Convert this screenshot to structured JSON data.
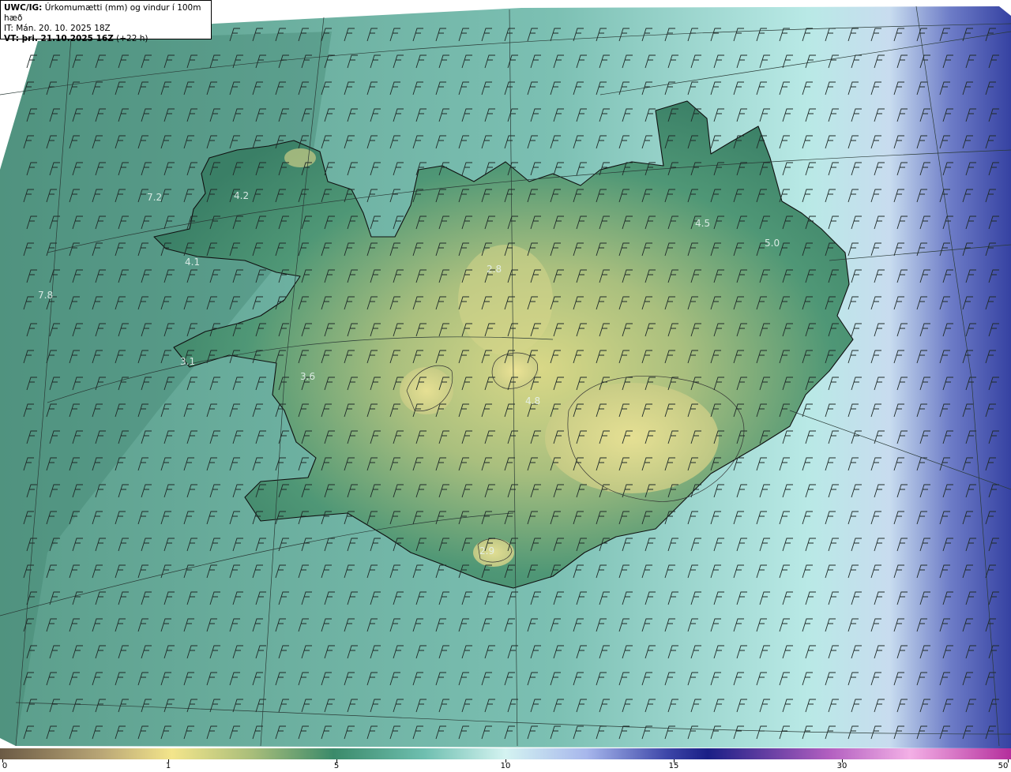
{
  "header": {
    "product": "UWC/IG:",
    "title": "Úrkomumætti (mm) og vindur í 100m hæð",
    "it_line": "IT: Mán. 20. 10. 2025 18Z",
    "vt_prefix": "VT: þri. 21.10.2025 16Z",
    "vt_suffix": "(+22 h)"
  },
  "map_labels": [
    {
      "text": "4.2"
    },
    {
      "text": "7.2"
    },
    {
      "text": "4.1"
    },
    {
      "text": "7.8"
    },
    {
      "text": "3.1"
    },
    {
      "text": "3.6"
    },
    {
      "text": "2.8"
    },
    {
      "text": "4.8"
    },
    {
      "text": "4.5"
    },
    {
      "text": "5.0"
    },
    {
      "text": "2.9"
    }
  ],
  "colorbar": {
    "ticks": [
      "0",
      "1",
      "5",
      "10",
      "15",
      "30",
      "50"
    ]
  },
  "colors": {
    "sea": "#7fb8ad",
    "land_low": "#3f8a6d",
    "land_high": "#e4e08e",
    "east_blue": "#3e4aa6"
  },
  "icons": {
    "wind_barb": "wind-barb-icon"
  }
}
